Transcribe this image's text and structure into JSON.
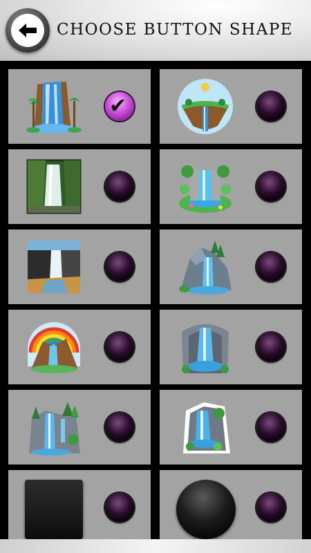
{
  "header": {
    "title": "CHOOSE BUTTON SHAPE",
    "back_icon": "back-arrow-icon"
  },
  "options": [
    {
      "name": "waterfall-cliff-palms",
      "selected": true
    },
    {
      "name": "floating-island-waterfall",
      "selected": false
    },
    {
      "name": "jungle-waterfall-photo",
      "selected": false
    },
    {
      "name": "cartoon-waterfall-pool",
      "selected": false
    },
    {
      "name": "canyon-waterfall-photo",
      "selected": false
    },
    {
      "name": "rocky-mountain-waterfall",
      "selected": false
    },
    {
      "name": "rainbow-waterfall",
      "selected": false
    },
    {
      "name": "grotto-waterfall",
      "selected": false
    },
    {
      "name": "forest-cliff-waterfall",
      "selected": false
    },
    {
      "name": "sticker-waterfall",
      "selected": false
    },
    {
      "name": "square-shape",
      "selected": false
    },
    {
      "name": "circle-shape",
      "selected": false
    }
  ],
  "colors": {
    "tile_bg": "#a3a3a3",
    "grid_bg": "#000000",
    "radio_selected": "#c94fd6",
    "radio_unselected": "#1a061c"
  }
}
